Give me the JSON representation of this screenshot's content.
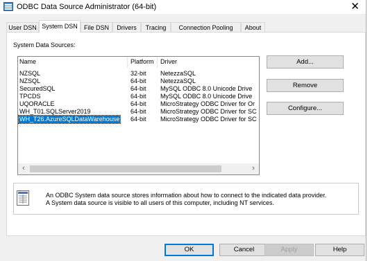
{
  "window": {
    "title": "ODBC Data Source Administrator (64-bit)",
    "close_glyph": "✕"
  },
  "tabs": [
    {
      "label": "User DSN",
      "active": false
    },
    {
      "label": "System DSN",
      "active": true
    },
    {
      "label": "File DSN",
      "active": false
    },
    {
      "label": "Drivers",
      "active": false
    },
    {
      "label": "Tracing",
      "active": false
    },
    {
      "label": "Connection Pooling",
      "active": false
    },
    {
      "label": "About",
      "active": false
    }
  ],
  "panel": {
    "sources_label": "System Data Sources:",
    "columns": [
      "Name",
      "Platform",
      "Driver"
    ],
    "rows": [
      {
        "name": "NZSQL",
        "platform": "32-bit",
        "driver": "NetezzaSQL"
      },
      {
        "name": "NZSQL",
        "platform": "64-bit",
        "driver": "NetezzaSQL"
      },
      {
        "name": "SecuredSQL",
        "platform": "64-bit",
        "driver": "MySQL ODBC 8.0 Unicode Drive"
      },
      {
        "name": "TPCDS",
        "platform": "64-bit",
        "driver": "MySQL ODBC 8.0 Unicode Drive"
      },
      {
        "name": "UQORACLE",
        "platform": "64-bit",
        "driver": "MicroStrategy ODBC Driver for Or"
      },
      {
        "name": "WH_T01.SQLServer2019",
        "platform": "64-bit",
        "driver": "MicroStrategy ODBC Driver for SC"
      },
      {
        "name": "WH_T26.AzureSQLDataWarehouse",
        "platform": "64-bit",
        "driver": "MicroStrategy ODBC Driver for SC"
      }
    ],
    "selected_row": 6,
    "scroll_left": "‹",
    "scroll_right": "›",
    "side_buttons": {
      "add": "Add...",
      "remove": "Remove",
      "configure": "Configure..."
    },
    "info_lines": [
      "An ODBC System data source stores information about how to connect to the indicated data provider.",
      "A System data source is visible to all users of this computer, including NT services."
    ]
  },
  "footer_buttons": {
    "ok": "OK",
    "cancel": "Cancel",
    "apply": "Apply",
    "help": "Help"
  },
  "colors": {
    "selection": "#0078d7",
    "window_bg": "#f0f0f0"
  },
  "icons": {
    "app": "odbc-admin-icon",
    "info": "database-document-icon"
  }
}
